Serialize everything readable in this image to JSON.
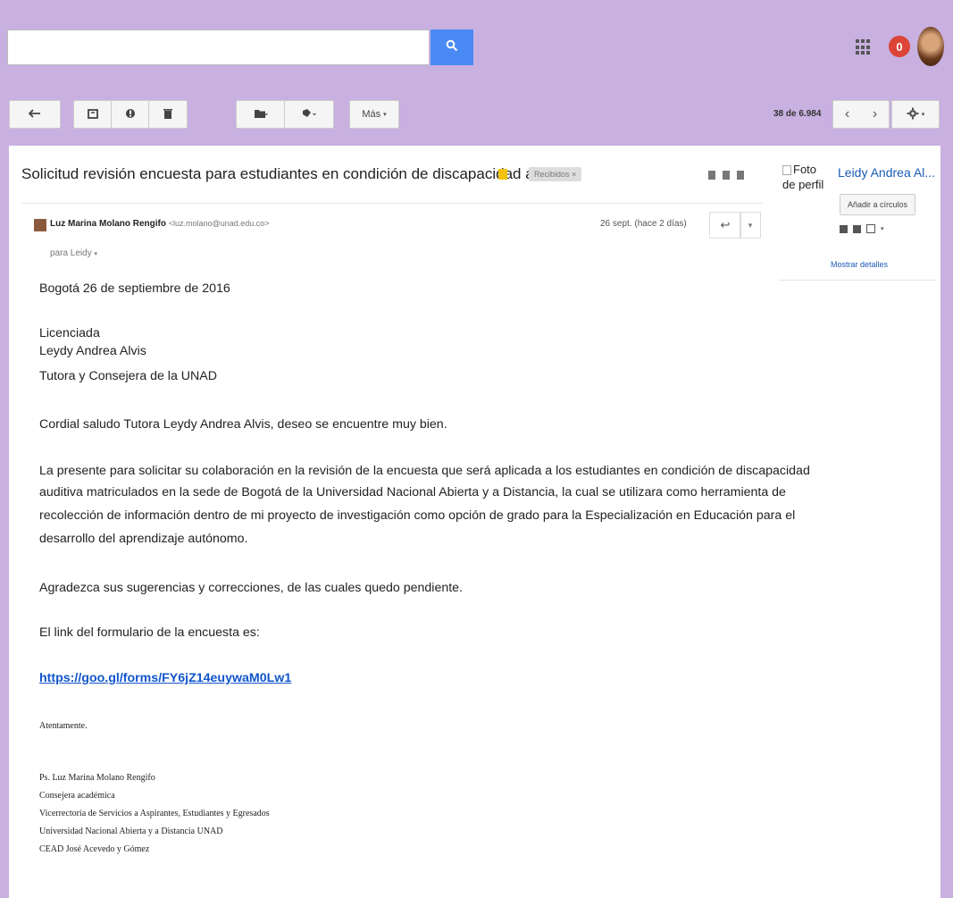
{
  "search": {
    "placeholder": ""
  },
  "topbar": {
    "notification_count": "0"
  },
  "toolbar": {
    "more_label": "Más",
    "counter": "38 de 6.984"
  },
  "email": {
    "subject": "Solicitud revisión encuesta para estudiantes en condición de discapacidad auditiva",
    "label": "Recibidos",
    "sender_name": "Luz Marina Molano Rengifo",
    "sender_email": "<luz.molano@unad.edu.co>",
    "recipient": "para Leidy",
    "date": "26 sept. (hace 2 días)",
    "body": {
      "date_line": "Bogotá 26 de septiembre de 2016",
      "recipient_title": "Licenciada",
      "recipient_name": "Leydy Andrea Alvis",
      "recipient_role": "Tutora y Consejera de la UNAD",
      "greeting": "Cordial saludo Tutora Leydy Andrea Alvis, deseo se encuentre muy bien.",
      "p1_l1": "La presente para solicitar su colaboración en la revisión de la encuesta que será aplicada a los estudiantes en condición de discapacidad",
      "p1_l2": "auditiva matriculados en la sede de Bogotá de la Universidad Nacional Abierta y a Distancia, la cual se utilizara como herramienta de",
      "p1_l3": "recolección de información dentro de mi proyecto de investigación como opción de grado para la Especialización en Educación para el",
      "p1_l4": "desarrollo del aprendizaje autónomo.",
      "thanks": "Agradezca sus sugerencias y correcciones, de las cuales quedo pendiente.",
      "link_intro": "El link del formulario de la encuesta es:",
      "link": "https://goo.gl/forms/FY6jZ14euywaM0Lw1",
      "closing": "Atentamente.",
      "sig_1": "Ps. Luz Marina Molano Rengifo",
      "sig_2": "Consejera académica",
      "sig_3": "Vicerrectoría de Servicios a Aspirantes, Estudiantes y Egresados",
      "sig_4": "Universidad Nacional Abierta y a Distancia UNAD",
      "sig_5": "CEAD José Acevedo y Gómez"
    }
  },
  "profile": {
    "image_alt": "Foto de perfil",
    "name": "Leidy Andrea Al...",
    "add_circles": "Añadir a círculos",
    "show_details": "Mostrar detalles"
  }
}
